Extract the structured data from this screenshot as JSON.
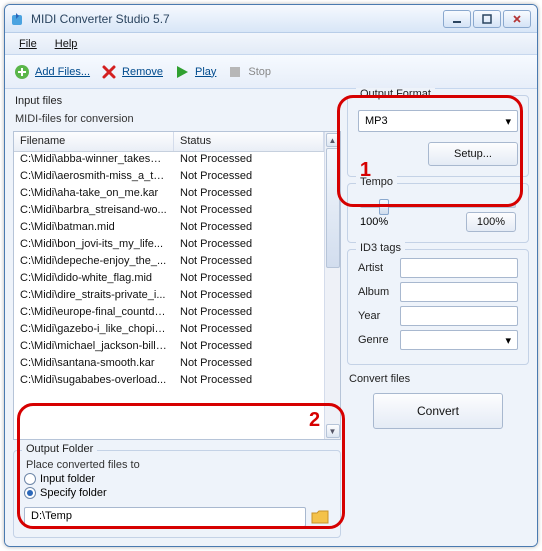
{
  "window": {
    "title": "MIDI Converter Studio 5.7"
  },
  "menu": {
    "file": "File",
    "help": "Help"
  },
  "toolbar": {
    "add": "Add Files...",
    "remove": "Remove",
    "play": "Play",
    "stop": "Stop"
  },
  "input": {
    "heading": "Input files",
    "subheading": "MIDI-files for conversion",
    "col_filename": "Filename",
    "col_status": "Status",
    "rows": [
      {
        "file": "C:\\Midi\\abba-winner_takes_i...",
        "status": "Not Processed"
      },
      {
        "file": "C:\\Midi\\aerosmith-miss_a_thi...",
        "status": "Not Processed"
      },
      {
        "file": "C:\\Midi\\aha-take_on_me.kar",
        "status": "Not Processed"
      },
      {
        "file": "C:\\Midi\\barbra_streisand-wo...",
        "status": "Not Processed"
      },
      {
        "file": "C:\\Midi\\batman.mid",
        "status": "Not Processed"
      },
      {
        "file": "C:\\Midi\\bon_jovi-its_my_life...",
        "status": "Not Processed"
      },
      {
        "file": "C:\\Midi\\depeche-enjoy_the_...",
        "status": "Not Processed"
      },
      {
        "file": "C:\\Midi\\dido-white_flag.mid",
        "status": "Not Processed"
      },
      {
        "file": "C:\\Midi\\dire_straits-private_i...",
        "status": "Not Processed"
      },
      {
        "file": "C:\\Midi\\europe-final_countdo...",
        "status": "Not Processed"
      },
      {
        "file": "C:\\Midi\\gazebo-i_like_chopin...",
        "status": "Not Processed"
      },
      {
        "file": "C:\\Midi\\michael_jackson-billie...",
        "status": "Not Processed"
      },
      {
        "file": "C:\\Midi\\santana-smooth.kar",
        "status": "Not Processed"
      },
      {
        "file": "C:\\Midi\\sugababes-overload...",
        "status": "Not Processed"
      }
    ]
  },
  "outputFormat": {
    "legend": "Output Format",
    "selected": "MP3",
    "setup": "Setup..."
  },
  "tempo": {
    "legend": "Tempo",
    "left": "100%",
    "btn": "100%"
  },
  "id3": {
    "legend": "ID3 tags",
    "artist_label": "Artist",
    "album_label": "Album",
    "year_label": "Year",
    "genre_label": "Genre",
    "artist": "",
    "album": "",
    "year": "",
    "genre": ""
  },
  "convert": {
    "legend": "Convert files",
    "button": "Convert"
  },
  "outputFolder": {
    "legend": "Output Folder",
    "instruction": "Place converted files to",
    "opt_input": "Input folder",
    "opt_specify": "Specify folder",
    "selected": "specify",
    "path": "D:\\Temp"
  },
  "annotations": {
    "one": "1",
    "two": "2"
  }
}
